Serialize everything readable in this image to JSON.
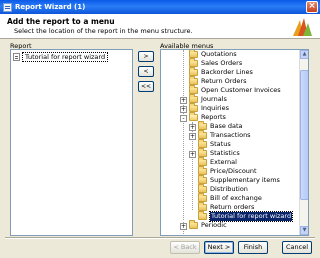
{
  "window": {
    "title": "Report Wizard (1)",
    "close_glyph": "×"
  },
  "header": {
    "title": "Add the report to a menu",
    "subtitle": "Select the location of the report in the menu structure."
  },
  "report_panel": {
    "label": "Report",
    "items": [
      "Tutorial for report wizard"
    ]
  },
  "move_buttons": {
    "add": ">",
    "remove": "<",
    "remove_all": "<<"
  },
  "menus_panel": {
    "label": "Available menus",
    "tree": [
      {
        "label": "Quotations"
      },
      {
        "label": "Sales Orders"
      },
      {
        "label": "Backorder Lines"
      },
      {
        "label": "Return Orders"
      },
      {
        "label": "Open Customer Invoices"
      },
      {
        "label": "Journals",
        "expander": "+"
      },
      {
        "label": "Inquiries",
        "expander": "+"
      },
      {
        "label": "Reports",
        "expander": "-"
      },
      {
        "label": "Base data",
        "expander": "+"
      },
      {
        "label": "Transactions",
        "expander": "+"
      },
      {
        "label": "Status"
      },
      {
        "label": "Statistics",
        "expander": "+"
      },
      {
        "label": "External"
      },
      {
        "label": "Price/Discount"
      },
      {
        "label": "Supplementary items"
      },
      {
        "label": "Distribution"
      },
      {
        "label": "Bill of exchange"
      },
      {
        "label": "Return orders"
      },
      {
        "label": "Tutorial for report wizard",
        "selected": true
      },
      {
        "label": "Periodic",
        "expander": "+"
      }
    ]
  },
  "footer": {
    "back": "< Back",
    "next": "Next >",
    "finish": "Finish",
    "cancel": "Cancel"
  },
  "colors": {
    "titlebar": "#0a5ae8",
    "selection": "#0a246a",
    "dialog": "#ece9d8"
  }
}
